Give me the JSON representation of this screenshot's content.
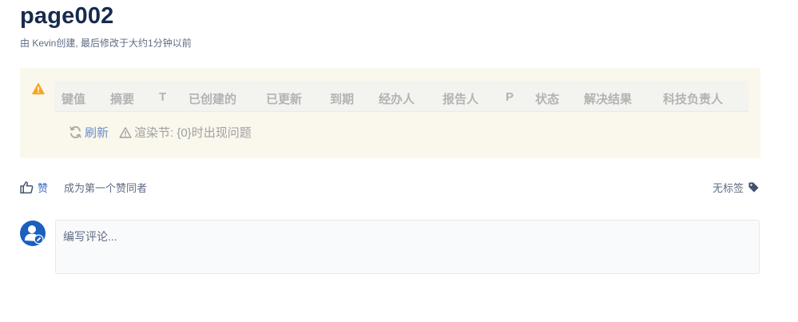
{
  "page": {
    "title": "page002",
    "byline": "由 Kevin创建, 最后修改于大约1分钟以前"
  },
  "jira_macro": {
    "columns": [
      "键值",
      "摘要",
      "T",
      "已创建的",
      "已更新",
      "到期",
      "经办人",
      "报告人",
      "P",
      "状态",
      "解决结果",
      "科技负责人"
    ],
    "refresh_label": "刷新",
    "error_text": "渲染节: {0}时出现问题",
    "warning_color": "#f6a623"
  },
  "footer": {
    "like_label": "赞",
    "like_hint": "成为第一个赞同者",
    "labels_text": "无标签"
  },
  "comment": {
    "placeholder": "编写评论..."
  },
  "icons": {
    "warning": "warning-icon",
    "refresh": "refresh-icon",
    "alert": "alert-triangle-icon",
    "like": "thumbs-up-icon",
    "tag": "tag-icon",
    "avatar": "user-avatar-icon"
  },
  "colors": {
    "title": "#172b4d",
    "link": "#3b6fc4",
    "panel_bg": "#faf7ec"
  }
}
